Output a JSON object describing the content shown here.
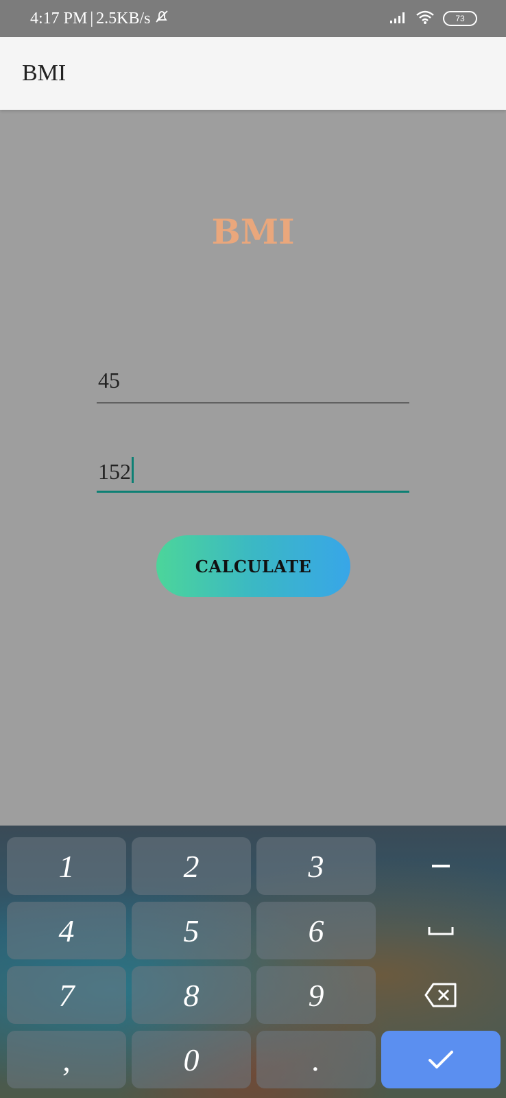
{
  "status_bar": {
    "time": "4:17 PM",
    "separator": "|",
    "net_speed": "2.5KB/s",
    "battery": "73",
    "icons": [
      "mute-bell-icon",
      "signal-icon",
      "wifi-icon",
      "battery-icon"
    ]
  },
  "app_bar": {
    "title": "BMI"
  },
  "main": {
    "heading": "BMI",
    "weight_value": "45",
    "height_value": "152",
    "calculate_label": "CALCULATE"
  },
  "keyboard": {
    "keys": [
      "1",
      "2",
      "3",
      "4",
      "5",
      "6",
      "7",
      "8",
      "9",
      ",",
      "0",
      "."
    ],
    "function_keys": [
      "minus-icon",
      "space-icon",
      "backspace-icon",
      "check-icon"
    ]
  },
  "colors": {
    "heading": "#eaa77c",
    "accent": "#0d8074",
    "button_gradient_start": "#4cd59a",
    "button_gradient_end": "#38a6e8",
    "enter_key": "#5b8ff0"
  }
}
